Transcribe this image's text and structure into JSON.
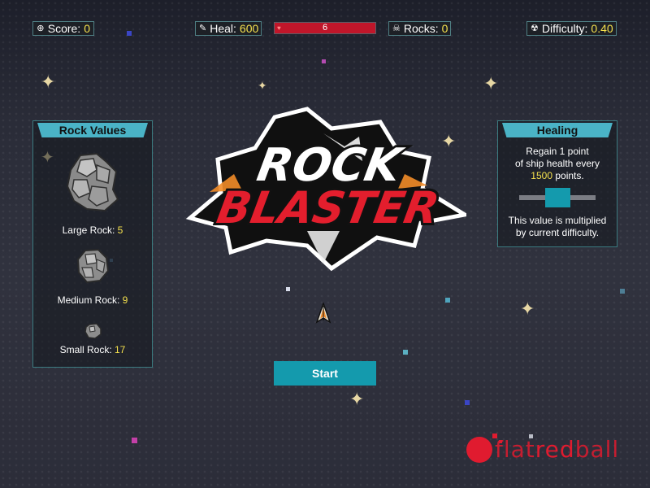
{
  "hud": {
    "score_label": "Score:",
    "score_value": "0",
    "heal_label": "Heal:",
    "heal_value": "600",
    "health_value": "6",
    "rocks_label": "Rocks:",
    "rocks_value": "0",
    "difficulty_label": "Difficulty:",
    "difficulty_value": "0.40"
  },
  "rock_values": {
    "title": "Rock Values",
    "large_label": "Large Rock:",
    "large_value": "5",
    "medium_label": "Medium Rock:",
    "medium_value": "9",
    "small_label": "Small Rock:",
    "small_value": "17"
  },
  "healing": {
    "title": "Healing",
    "line1": "Regain 1 point",
    "line2": "of ship health every",
    "points_value": "1500",
    "points_suffix": "points.",
    "note_line1": "This value is multiplied",
    "note_line2": "by current difficulty."
  },
  "logo": {
    "line1": "ROCK",
    "line2": "BLASTER"
  },
  "start_label": "Start",
  "brand": {
    "flat": "flat",
    "red": "red",
    "ball": "ball"
  },
  "colors": {
    "accent": "#149aad",
    "panel_header": "#4ab3c6",
    "value_yellow": "#f4e04d",
    "health_red": "#c0162a",
    "brand_red": "#e01b2f"
  },
  "icons": {
    "score": "crosshair-icon",
    "heal": "wrench-icon",
    "health": "heart-icon",
    "rocks": "skull-icon",
    "difficulty": "radiation-icon"
  }
}
